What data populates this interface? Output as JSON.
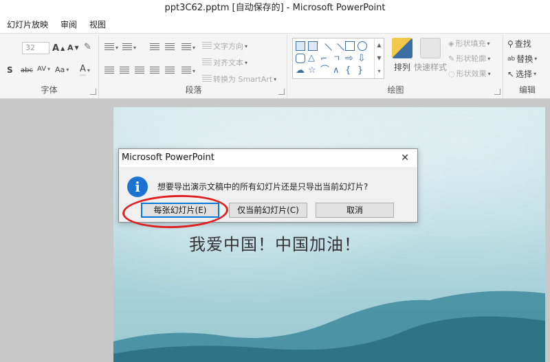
{
  "window": {
    "title": "ppt3C62.pptm [自动保存的] - Microsoft PowerPoint"
  },
  "menu": {
    "items": [
      "幻灯片放映",
      "审阅",
      "视图"
    ]
  },
  "ribbon": {
    "font_group": {
      "label": "字体",
      "font_size": "32",
      "change_case": "Aa"
    },
    "paragraph_group": {
      "label": "段落",
      "text_direction": "文字方向",
      "align_text": "对齐文本",
      "convert_smartart": "转换为 SmartArt"
    },
    "drawing_group": {
      "label": "绘图",
      "arrange": "排列",
      "quick_styles": "快速样式",
      "shape_fill": "形状填充",
      "shape_outline": "形状轮廓",
      "shape_effects": "形状效果"
    },
    "editing_group": {
      "label": "编辑",
      "find": "查找",
      "replace": "替换",
      "select": "选择"
    }
  },
  "slide": {
    "text": "我爱中国！中国加油！"
  },
  "dialog": {
    "title": "Microsoft PowerPoint",
    "close": "✕",
    "message": "想要导出演示文稿中的所有幻灯片还是只导出当前幻灯片?",
    "btn_every": "每张幻灯片(E)",
    "btn_current": "仅当前幻灯片(C)",
    "btn_cancel": "取消"
  },
  "colors": {
    "accent": "#0078d7",
    "info_icon": "#1a73d1",
    "highlight": "#e02020"
  }
}
